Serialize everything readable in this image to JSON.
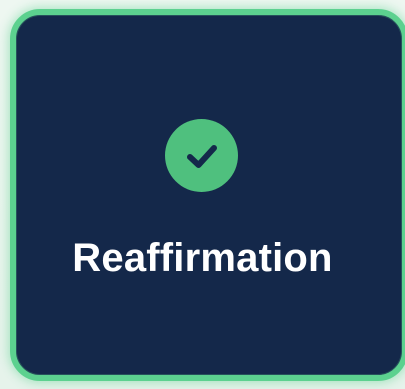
{
  "card": {
    "label": "Reaffirmation",
    "status_icon": "check-circle-icon"
  },
  "colors": {
    "background": "#e9f5ee",
    "card_fill": "#14284a",
    "card_border": "#5cd18f",
    "badge_fill": "#4fc07e",
    "checkmark": "#14284a",
    "label_text": "#ffffff"
  }
}
